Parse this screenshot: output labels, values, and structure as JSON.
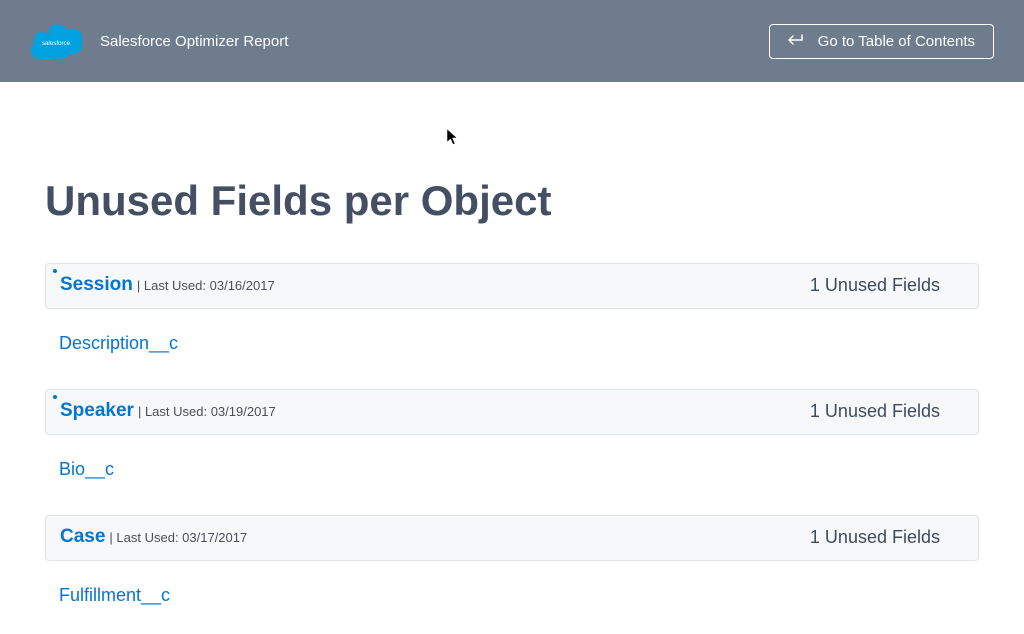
{
  "header": {
    "logo_text": "salesforce",
    "title": "Salesforce Optimizer Report",
    "toc_button_label": "Go to Table of Contents"
  },
  "page": {
    "title": "Unused Fields per Object"
  },
  "objects": [
    {
      "name": "Session",
      "last_used_label": " | Last Used: 03/16/2017",
      "unused_count_label": "1 Unused Fields",
      "fields": [
        "Description__c"
      ]
    },
    {
      "name": "Speaker",
      "last_used_label": " | Last Used: 03/19/2017",
      "unused_count_label": "1 Unused Fields",
      "fields": [
        "Bio__c"
      ]
    },
    {
      "name": "Case",
      "last_used_label": " | Last Used: 03/17/2017",
      "unused_count_label": "1 Unused Fields",
      "fields": [
        "Fulfillment__c"
      ]
    }
  ]
}
